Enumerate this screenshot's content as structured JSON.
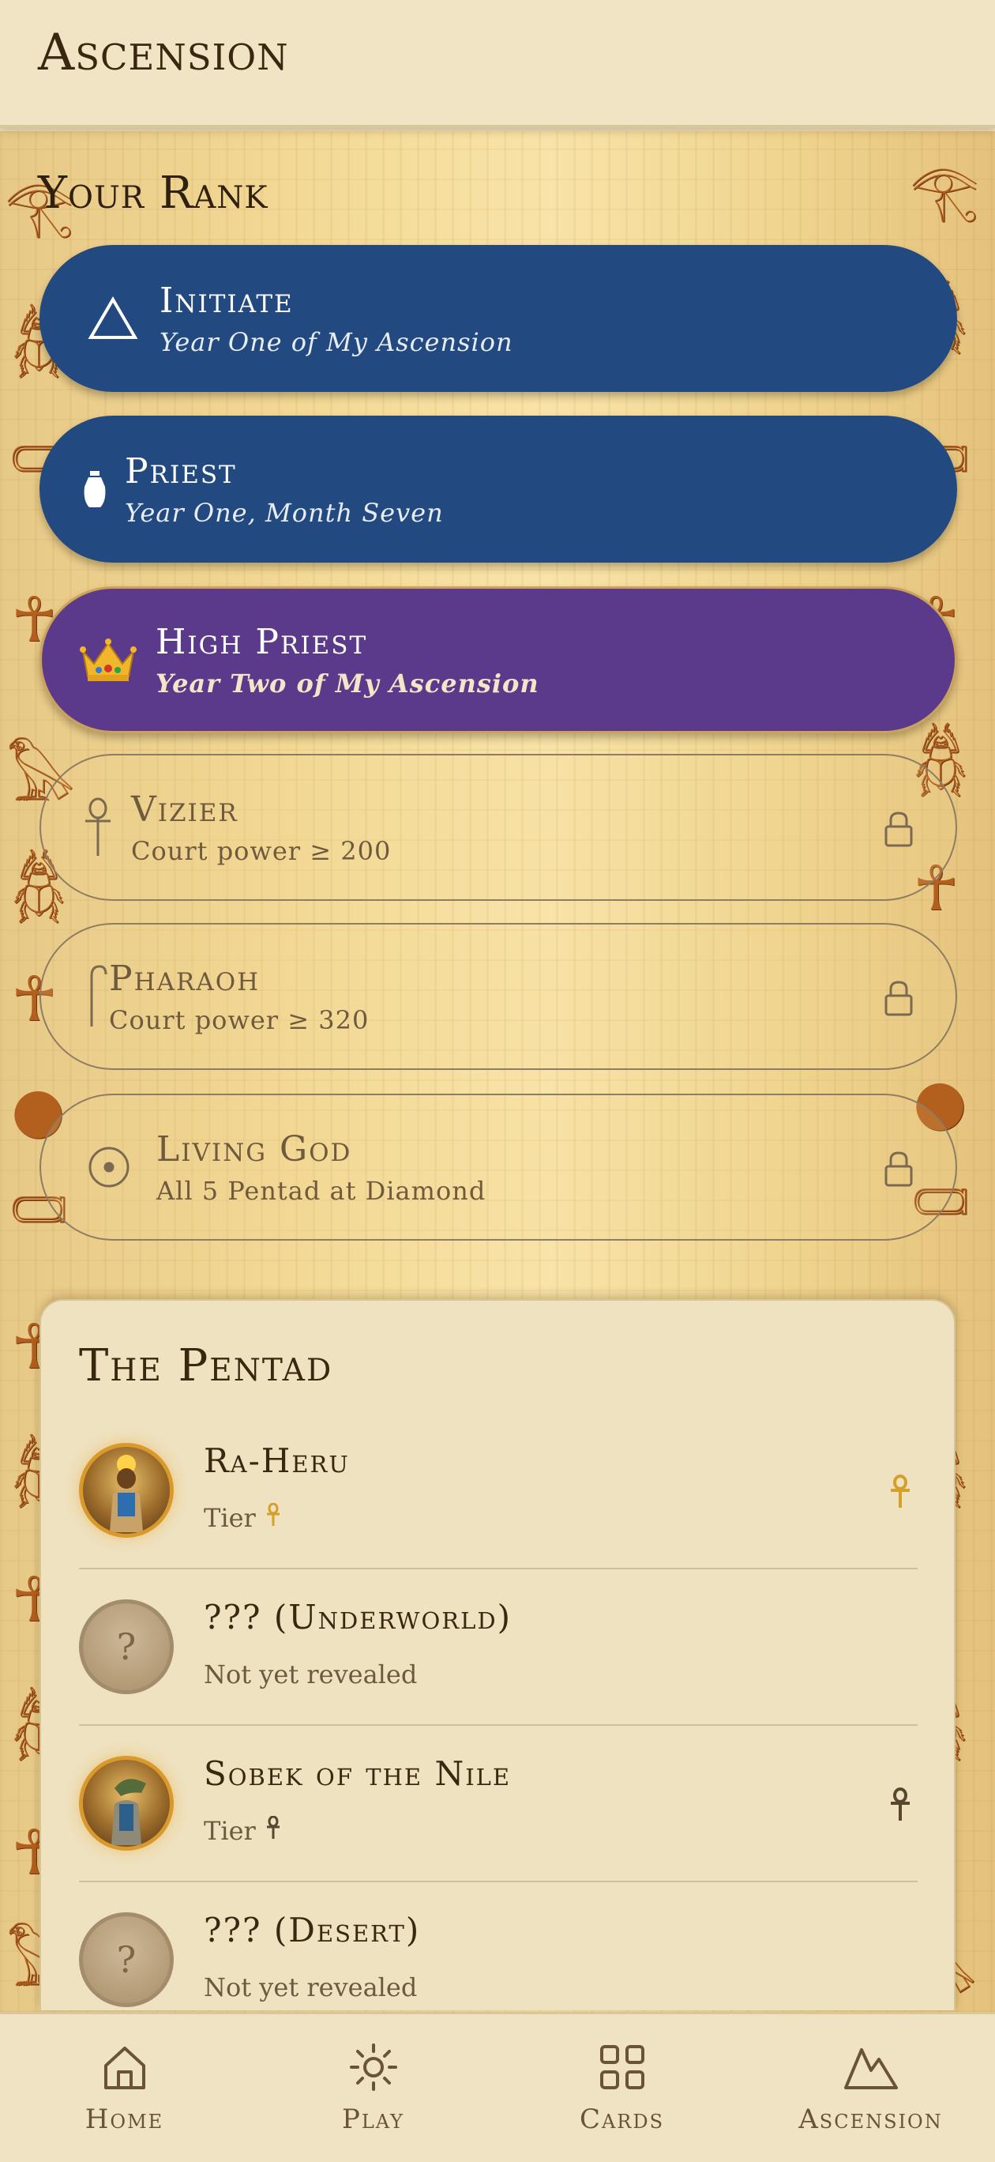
{
  "app": {
    "title": "Ascension"
  },
  "rank": {
    "heading": "Your Rank",
    "items": [
      {
        "name": "Initiate",
        "subtitle": "Year One of My Ascension",
        "state": "achieved",
        "icon": "triangle-icon"
      },
      {
        "name": "Priest",
        "subtitle": "Year One, Month Seven",
        "state": "achieved",
        "icon": "vase-icon"
      },
      {
        "name": "High Priest",
        "subtitle": "Year Two of My Ascension",
        "state": "current",
        "icon": "crown-icon"
      },
      {
        "name": "Vizier",
        "subtitle": "Court power ≥ 200",
        "state": "locked",
        "icon": "ankh-icon"
      },
      {
        "name": "Pharaoh",
        "subtitle": "Court power ≥ 320",
        "state": "locked",
        "icon": "crook-icon"
      },
      {
        "name": "Living God",
        "subtitle": "All 5 Pentad at Diamond",
        "state": "locked",
        "icon": "sun-disc-icon"
      }
    ]
  },
  "pentad": {
    "title": "The Pentad",
    "items": [
      {
        "name": "Ra-Heru",
        "subtitle": "Tier",
        "revealed": true,
        "tier_color": "#d4a02a"
      },
      {
        "name": "??? (Underworld)",
        "subtitle": "Not yet revealed",
        "revealed": false,
        "placeholder": "?"
      },
      {
        "name": "Sobek of the Nile",
        "subtitle": "Tier",
        "revealed": true,
        "tier_color": "#5a4630"
      },
      {
        "name": "??? (Desert)",
        "subtitle": "Not yet revealed",
        "revealed": false,
        "placeholder": "?"
      }
    ]
  },
  "nav": {
    "items": [
      {
        "label": "Home",
        "icon": "home-icon"
      },
      {
        "label": "Play",
        "icon": "sun-icon"
      },
      {
        "label": "Cards",
        "icon": "grid-icon"
      },
      {
        "label": "Ascension",
        "icon": "mountain-icon"
      }
    ]
  },
  "colors": {
    "achieved": "#224a80",
    "current": "#5b3a8c",
    "gold": "#d99a2b",
    "background": "#efe3c3"
  }
}
